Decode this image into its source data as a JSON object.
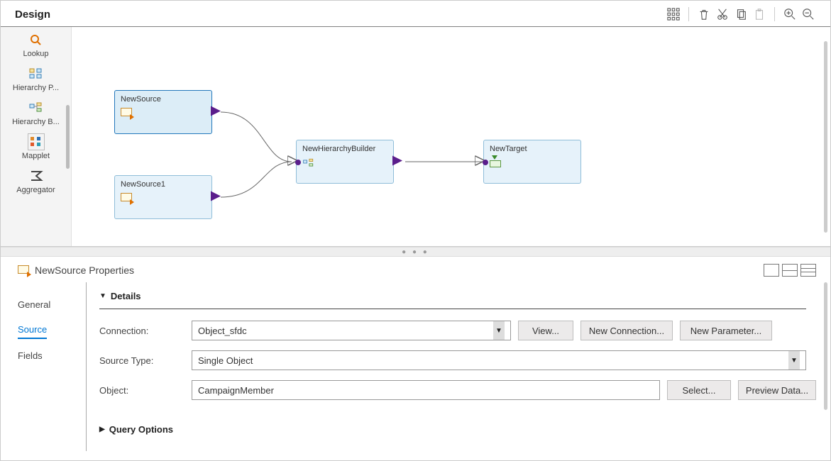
{
  "header": {
    "title": "Design"
  },
  "palette": {
    "items": [
      {
        "label": "Lookup"
      },
      {
        "label": "Hierarchy P..."
      },
      {
        "label": "Hierarchy B..."
      },
      {
        "label": "Mapplet"
      },
      {
        "label": "Aggregator"
      }
    ]
  },
  "canvas": {
    "nodes": {
      "src1": {
        "title": "NewSource"
      },
      "src2": {
        "title": "NewSource1"
      },
      "hb": {
        "title": "NewHierarchyBuilder"
      },
      "tgt": {
        "title": "NewTarget"
      }
    }
  },
  "panel": {
    "title": "NewSource Properties",
    "tabs": [
      "General",
      "Source",
      "Fields"
    ],
    "activeTab": "Source",
    "section": "Details",
    "section2": "Query Options",
    "labels": {
      "connection": "Connection:",
      "sourceType": "Source Type:",
      "object": "Object:"
    },
    "values": {
      "connection": "Object_sfdc",
      "sourceType": "Single Object",
      "object": "CampaignMember"
    },
    "buttons": {
      "view": "View...",
      "newConn": "New Connection...",
      "newParam": "New Parameter...",
      "select": "Select...",
      "preview": "Preview Data..."
    }
  }
}
